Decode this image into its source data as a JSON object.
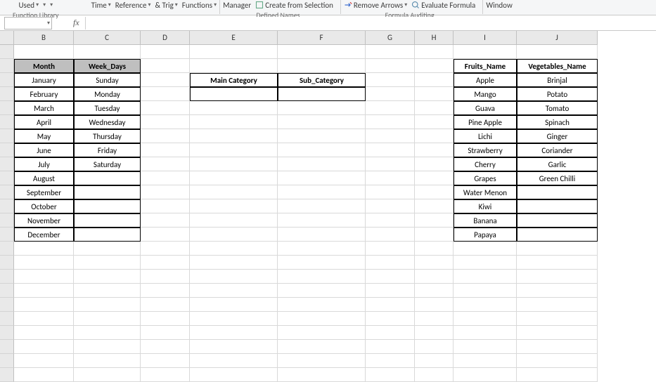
{
  "ribbon": {
    "recently_used": "Used",
    "time": "Time",
    "reference": "Reference",
    "trig": "& Trig",
    "functions": "Functions",
    "manager": "Manager",
    "create_from_selection": "Create from Selection",
    "remove_arrows": "Remove Arrows",
    "evaluate_formula": "Evaluate Formula",
    "window": "Window",
    "group_function_library": "Function Library",
    "group_defined_names": "Defined Names",
    "group_formula_auditing": "Formula Auditing"
  },
  "name_box": "",
  "fx_label": "fx",
  "formula": "",
  "columns": [
    "B",
    "C",
    "D",
    "E",
    "F",
    "G",
    "H",
    "I",
    "J"
  ],
  "row_numbers_empty": true,
  "tables": {
    "month_week": {
      "headers": [
        "Month",
        "Week_Days"
      ],
      "rows": [
        [
          "January",
          "Sunday"
        ],
        [
          "February",
          "Monday"
        ],
        [
          "March",
          "Tuesday"
        ],
        [
          "April",
          "Wednesday"
        ],
        [
          "May",
          "Thursday"
        ],
        [
          "June",
          "Friday"
        ],
        [
          "July",
          "Saturday"
        ],
        [
          "August",
          ""
        ],
        [
          "September",
          ""
        ],
        [
          "October",
          ""
        ],
        [
          "November",
          ""
        ],
        [
          "December",
          ""
        ]
      ]
    },
    "category": {
      "headers": [
        "Main Category",
        "Sub_Category"
      ]
    },
    "produce": {
      "headers": [
        "Fruits_Name",
        "Vegetables_Name"
      ],
      "rows": [
        [
          "Apple",
          "Brinjal"
        ],
        [
          "Mango",
          "Potato"
        ],
        [
          "Guava",
          "Tomato"
        ],
        [
          "Pine Apple",
          "Spinach"
        ],
        [
          "Lichi",
          "Ginger"
        ],
        [
          "Strawberry",
          "Coriander"
        ],
        [
          "Cherry",
          "Garlic"
        ],
        [
          "Grapes",
          "Green Chilli"
        ],
        [
          "Water Menon",
          ""
        ],
        [
          "Kiwi",
          ""
        ],
        [
          "Banana",
          ""
        ],
        [
          "Papaya",
          ""
        ]
      ]
    }
  }
}
